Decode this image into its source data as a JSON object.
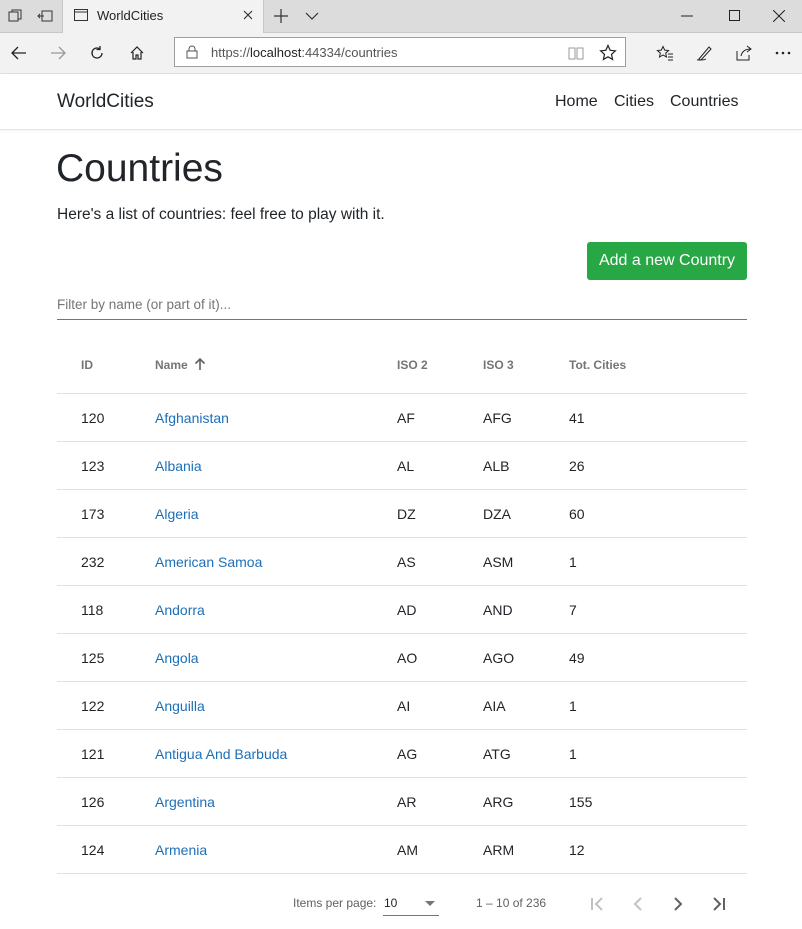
{
  "browser": {
    "tab_title": "WorldCities",
    "url_scheme": "https://",
    "url_host": "localhost",
    "url_rest": ":44334/countries"
  },
  "app": {
    "brand": "WorldCities",
    "nav": [
      "Home",
      "Cities",
      "Countries"
    ]
  },
  "page": {
    "title": "Countries",
    "lead": "Here's a list of countries: feel free to play with it.",
    "add_button": "Add a new Country",
    "filter_placeholder": "Filter by name (or part of it)..."
  },
  "table": {
    "columns": [
      "ID",
      "Name",
      "ISO 2",
      "ISO 3",
      "Tot. Cities"
    ],
    "sorted_column": "Name",
    "sort_direction": "ascending",
    "rows": [
      {
        "id": "120",
        "name": "Afghanistan",
        "iso2": "AF",
        "iso3": "AFG",
        "cities": "41"
      },
      {
        "id": "123",
        "name": "Albania",
        "iso2": "AL",
        "iso3": "ALB",
        "cities": "26"
      },
      {
        "id": "173",
        "name": "Algeria",
        "iso2": "DZ",
        "iso3": "DZA",
        "cities": "60"
      },
      {
        "id": "232",
        "name": "American Samoa",
        "iso2": "AS",
        "iso3": "ASM",
        "cities": "1"
      },
      {
        "id": "118",
        "name": "Andorra",
        "iso2": "AD",
        "iso3": "AND",
        "cities": "7"
      },
      {
        "id": "125",
        "name": "Angola",
        "iso2": "AO",
        "iso3": "AGO",
        "cities": "49"
      },
      {
        "id": "122",
        "name": "Anguilla",
        "iso2": "AI",
        "iso3": "AIA",
        "cities": "1"
      },
      {
        "id": "121",
        "name": "Antigua And Barbuda",
        "iso2": "AG",
        "iso3": "ATG",
        "cities": "1"
      },
      {
        "id": "126",
        "name": "Argentina",
        "iso2": "AR",
        "iso3": "ARG",
        "cities": "155"
      },
      {
        "id": "124",
        "name": "Armenia",
        "iso2": "AM",
        "iso3": "ARM",
        "cities": "12"
      }
    ]
  },
  "paginator": {
    "items_per_page_label": "Items per page:",
    "items_per_page": "10",
    "range": "1 – 10 of 236"
  },
  "colors": {
    "primary_button": "#28a745",
    "link": "#1e6fb8",
    "text": "#212529"
  }
}
